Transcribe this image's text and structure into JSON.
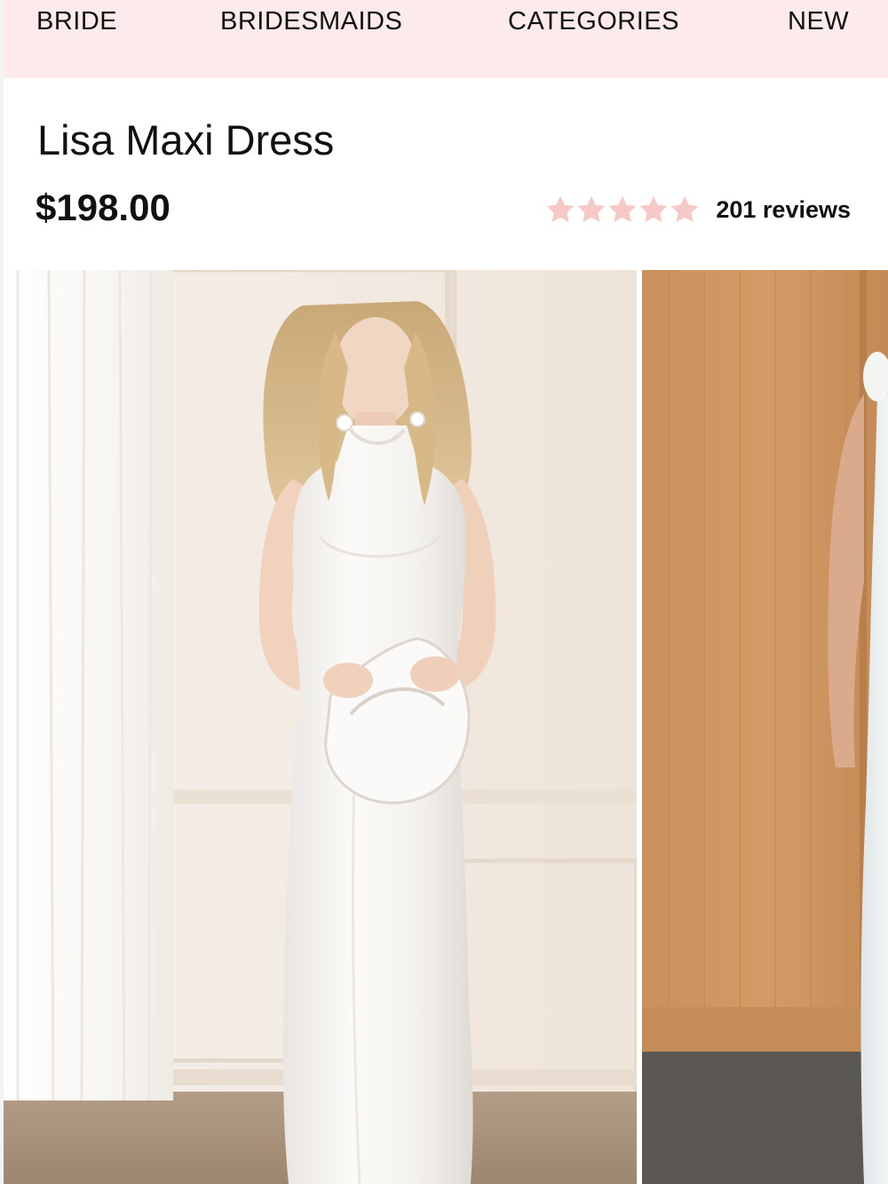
{
  "nav": {
    "items": [
      {
        "label": "BRIDE"
      },
      {
        "label": "BRIDESMAIDS"
      },
      {
        "label": "CATEGORIES"
      },
      {
        "label": "NEW"
      }
    ]
  },
  "product": {
    "title": "Lisa Maxi Dress",
    "price": "$198.00",
    "rating": {
      "stars": 5,
      "reviews_label": "201 reviews",
      "star_color": "#f7c9c6"
    }
  },
  "gallery": {
    "images": [
      {
        "name": "product-photo-front"
      },
      {
        "name": "product-photo-back"
      }
    ]
  },
  "colors": {
    "nav_background": "#fcebea",
    "text": "#111111",
    "star": "#f7c9c6"
  }
}
